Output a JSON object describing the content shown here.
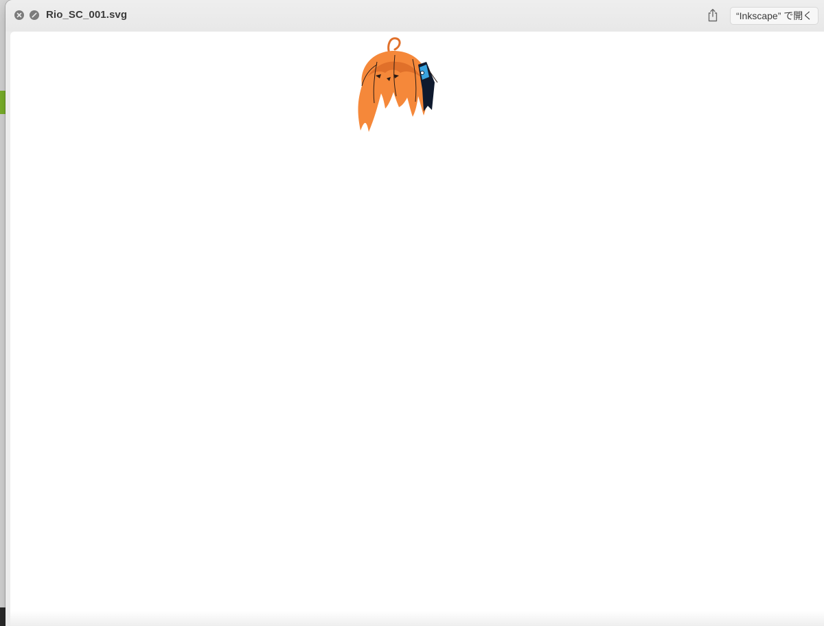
{
  "window": {
    "title": "Rio_SC_001.svg",
    "open_with_label": "“Inkscape” で開く"
  },
  "icons": {
    "close": "close-icon",
    "fullscreen": "fullscreen-icon",
    "share": "share-icon"
  },
  "preview": {
    "artwork": "orange-hair-illustration",
    "colors": {
      "hair": "#f5883a",
      "hair_dark": "#e0702a",
      "line": "#2b1b14",
      "accessory": "#3aa3df",
      "accessory_dark": "#0f1a2e"
    }
  }
}
